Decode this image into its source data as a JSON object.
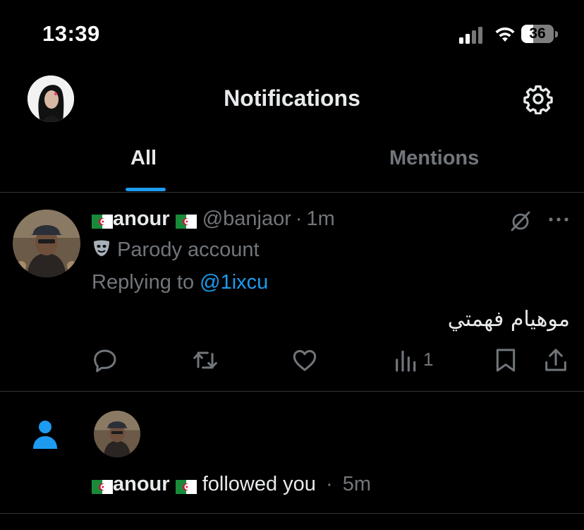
{
  "status_bar": {
    "time": "13:39",
    "battery": "36",
    "battery_level": 0.36
  },
  "header": {
    "title": "Notifications",
    "settings_icon": "gear-icon",
    "avatar_icon": "profile-avatar"
  },
  "tabs": [
    {
      "label": "All",
      "active": true
    },
    {
      "label": "Mentions",
      "active": false
    }
  ],
  "colors": {
    "accent": "#1d9bf0",
    "secondary_text": "#71767b",
    "background": "#000000"
  },
  "notifications": {
    "reply": {
      "name": "anour",
      "handle": "@banjaor",
      "separator": "·",
      "time": "1m",
      "parody_label": "Parody account",
      "replying_prefix": "Replying to",
      "replying_to": "@1ixcu",
      "text": "موهيام فهمتي",
      "views": "1",
      "actions": [
        "reply-icon",
        "retweet-icon",
        "like-icon",
        "views-icon",
        "bookmark-icon",
        "share-icon"
      ]
    },
    "follow": {
      "name": "anour",
      "action_text": "followed you",
      "separator": "·",
      "time": "5m"
    }
  }
}
